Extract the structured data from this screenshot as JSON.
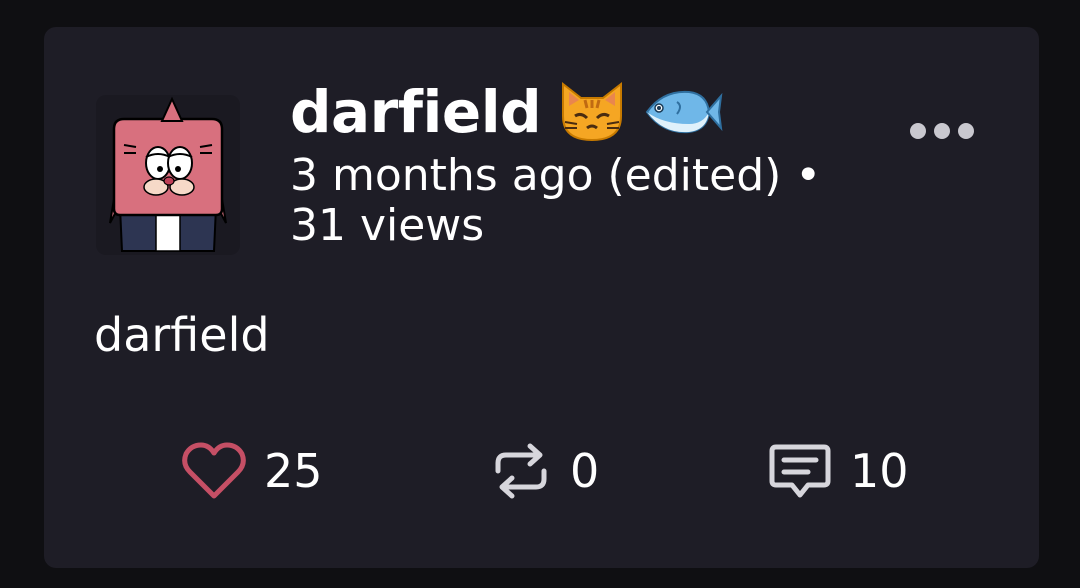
{
  "post": {
    "author": {
      "name": "darfield",
      "name_emojis": [
        "cat-face-icon",
        "fish-icon"
      ]
    },
    "timestamp": "3 months ago (edited) •",
    "views": "31 views",
    "body": "darfield",
    "actions": {
      "likes": "25",
      "reposts": "0",
      "comments": "10"
    }
  },
  "colors": {
    "background": "#0f0f12",
    "card": "#1e1d26",
    "text": "#ffffff",
    "like_heart": "#c54f65",
    "icon_gray": "#d7d6dc",
    "avatar_pink": "#d8707e",
    "avatar_navy": "#2d3552"
  }
}
